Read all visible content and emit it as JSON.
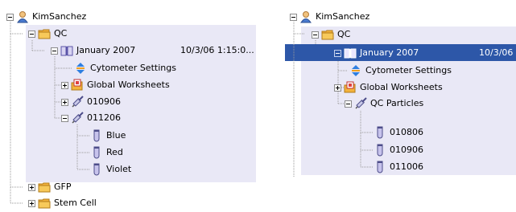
{
  "left_tree": {
    "root": "KimSanchez",
    "folder_qc": "QC",
    "experiment": {
      "label": "January 2007",
      "date": "10/3/06 1:15:0..."
    },
    "cytometer_settings": "Cytometer Settings",
    "global_worksheets": "Global Worksheets",
    "specimen_1": "010906",
    "specimen_2": "011206",
    "tubes": [
      "Blue",
      "Red",
      "Violet"
    ],
    "folder_gfp": "GFP",
    "folder_stem_cell": "Stem Cell"
  },
  "right_tree": {
    "root": "KimSanchez",
    "folder_qc": "QC",
    "experiment": {
      "label": "January 2007",
      "date": "10/3/06"
    },
    "cytometer_settings": "Cytometer Settings",
    "global_worksheets": "Global Worksheets",
    "specimen": "QC Particles",
    "tubes": [
      "010806",
      "010906",
      "011006"
    ]
  },
  "colors": {
    "selection": "#2d57a8",
    "band": "#e9e8f6",
    "folder": "#f3b33c"
  },
  "icons": {
    "user": "user-icon",
    "folder": "folder-icon",
    "experiment": "book-icon",
    "settings": "settings-icon",
    "worksheets": "worksheets-icon",
    "specimen": "syringe-icon",
    "tube": "tube-icon"
  }
}
